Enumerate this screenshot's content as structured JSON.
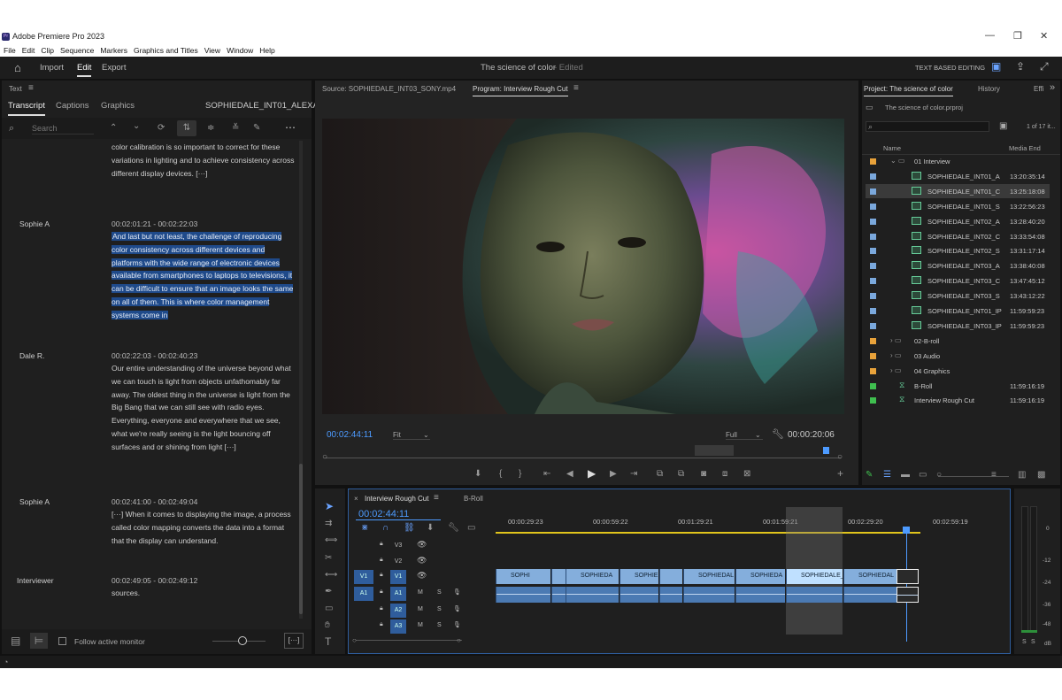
{
  "app": {
    "title": "Adobe Premiere Pro 2023",
    "logo": "Pr"
  },
  "menu": [
    "File",
    "Edit",
    "Clip",
    "Sequence",
    "Markers",
    "Graphics and Titles",
    "View",
    "Window",
    "Help"
  ],
  "workspace": {
    "tabs": [
      "Import",
      "Edit",
      "Export"
    ],
    "project_title": "The science of color",
    "status": "- Edited",
    "text_based": "TEXT BASED EDITING"
  },
  "text_panel": {
    "title": "Text",
    "tabs": [
      "Transcript",
      "Captions",
      "Graphics"
    ],
    "clip_name": "SOPHIEDALE_INT01_ALEXA",
    "search_placeholder": "Search",
    "segments": [
      {
        "speaker": "",
        "time": "",
        "text": "color calibration is so important to correct for these variations in lighting and to achieve consistency across different display devices. [···]"
      },
      {
        "speaker": "Sophie A",
        "time": "00:02:01:21 - 00:02:22:03",
        "text": "And last but not least, the challenge of reproducing color consistency across different devices and platforms with the wide range of electronic devices available from smartphones to laptops to televisions, it can be difficult to ensure that an image looks the same on all of them. This is where color management systems come in"
      },
      {
        "speaker": "Dale R.",
        "time": "00:02:22:03 - 00:02:40:23",
        "text": "Our entire understanding of the universe beyond what we can touch is light from objects unfathomably far away. The oldest thing in the universe is light from the Big Bang that we can still see with radio eyes. Everything, everyone and everywhere that we see, what we're really seeing is the light bouncing off surfaces and or shining from light [···]"
      },
      {
        "speaker": "Sophie A",
        "time": "00:02:41:00 - 00:02:49:04",
        "text": "[···] When it comes to displaying the image, a process called color mapping converts the data into a format that the display can understand."
      },
      {
        "speaker": "Interviewer",
        "time": "00:02:49:05 - 00:02:49:12",
        "text": "sources."
      }
    ],
    "follow": "Follow active monitor",
    "more": "[···]"
  },
  "monitor": {
    "source_tab": "Source: SOPHIEDALE_INT03_SONY.mp4",
    "program_tab": "Program: Interview Rough Cut",
    "timecode": "00:02:44:11",
    "fit": "Fit",
    "quality": "Full",
    "duration": "00:00:20:06"
  },
  "project": {
    "tabs": [
      "Project: The science of color",
      "History",
      "Effi"
    ],
    "file": "The science of color.prproj",
    "count": "1 of 17 it...",
    "col_name": "Name",
    "col_media_end": "Media End",
    "rows": [
      {
        "name": "01 Interview",
        "time": "",
        "color": "#e8a23a",
        "type": "bin"
      },
      {
        "name": "SOPHIEDALE_INT01_A",
        "time": "13:20:35:14",
        "color": "#7aa8dc",
        "type": "clip"
      },
      {
        "name": "SOPHIEDALE_INT01_C",
        "time": "13:25:18:08",
        "color": "#7aa8dc",
        "type": "clip"
      },
      {
        "name": "SOPHIEDALE_INT01_S",
        "time": "13:22:56:23",
        "color": "#7aa8dc",
        "type": "clip"
      },
      {
        "name": "SOPHIEDALE_INT02_A",
        "time": "13:28:40:20",
        "color": "#7aa8dc",
        "type": "clip"
      },
      {
        "name": "SOPHIEDALE_INT02_C",
        "time": "13:33:54:08",
        "color": "#7aa8dc",
        "type": "clip"
      },
      {
        "name": "SOPHIEDALE_INT02_S",
        "time": "13:31:17:14",
        "color": "#7aa8dc",
        "type": "clip"
      },
      {
        "name": "SOPHIEDALE_INT03_A",
        "time": "13:38:40:08",
        "color": "#7aa8dc",
        "type": "clip"
      },
      {
        "name": "SOPHIEDALE_INT03_C",
        "time": "13:47:45:12",
        "color": "#7aa8dc",
        "type": "clip"
      },
      {
        "name": "SOPHIEDALE_INT03_S",
        "time": "13:43:12:22",
        "color": "#7aa8dc",
        "type": "clip"
      },
      {
        "name": "SOPHIEDALE_INT01_IP",
        "time": "11:59:59:23",
        "color": "#7aa8dc",
        "type": "clip"
      },
      {
        "name": "SOPHIEDALE_INT03_IP",
        "time": "11:59:59:23",
        "color": "#7aa8dc",
        "type": "clip"
      },
      {
        "name": "02-B-roll",
        "time": "",
        "color": "#e8a23a",
        "type": "bin"
      },
      {
        "name": "03 Audio",
        "time": "",
        "color": "#e8a23a",
        "type": "bin"
      },
      {
        "name": "04 Graphics",
        "time": "",
        "color": "#e8a23a",
        "type": "bin"
      },
      {
        "name": "B-Roll",
        "time": "11:59:16:19",
        "color": "#3fbf4f",
        "type": "seq"
      },
      {
        "name": "Interview Rough Cut",
        "time": "11:59:16:19",
        "color": "#3fbf4f",
        "type": "seq"
      }
    ]
  },
  "timeline": {
    "tabs": [
      "Interview Rough Cut",
      "B-Roll"
    ],
    "timecode": "00:02:44:11",
    "ruler": [
      "00:00:29:23",
      "00:00:59:22",
      "00:01:29:21",
      "00:01:59:21",
      "00:02:29:20",
      "00:02:59:19"
    ],
    "tracks": [
      "V3",
      "V2",
      "V1",
      "A1",
      "A2",
      "A3"
    ],
    "clips": [
      "SOPHI",
      "SOPHIEDA",
      "SOPHIE",
      "SOPHIEDAL",
      "SOPHIEDA",
      "SOPHIEDALE_",
      "SOPHIEDAL"
    ]
  },
  "meter": {
    "labels": [
      "0",
      "-12",
      "-24",
      "-36",
      "-48",
      "dB"
    ],
    "solo": [
      "S",
      "S"
    ]
  }
}
